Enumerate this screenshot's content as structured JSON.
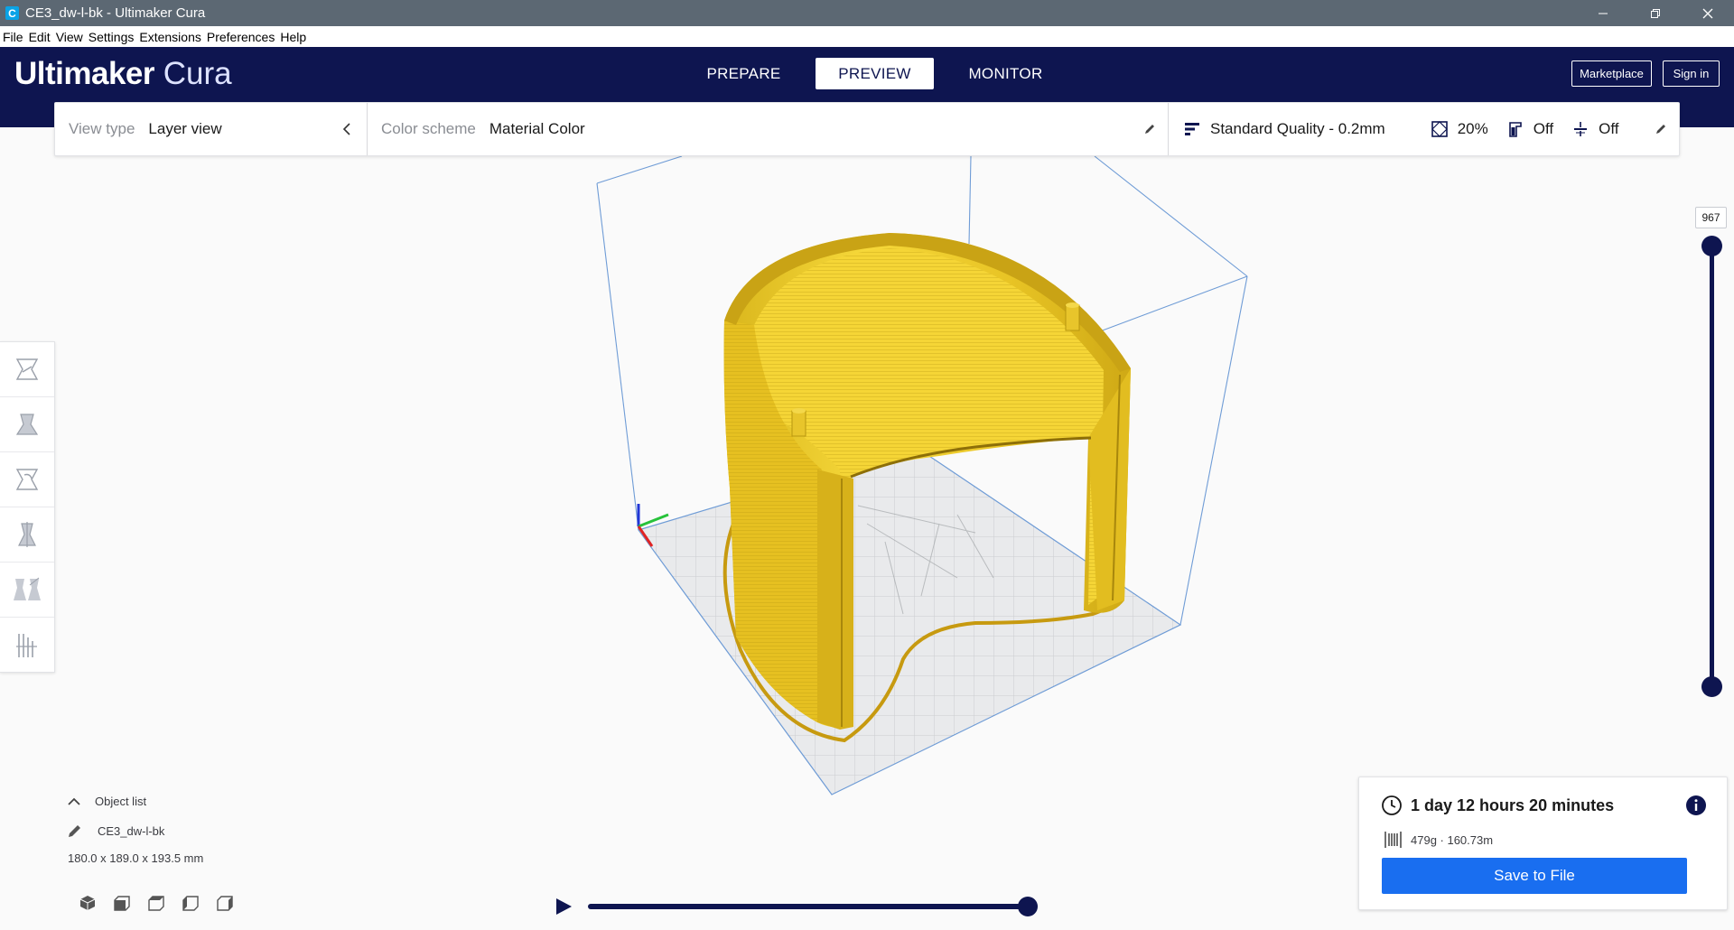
{
  "window": {
    "title": "CE3_dw-l-bk - Ultimaker Cura",
    "app_icon": "C"
  },
  "menu": [
    "File",
    "Edit",
    "View",
    "Settings",
    "Extensions",
    "Preferences",
    "Help"
  ],
  "header": {
    "brand_bold": "Ultimaker",
    "brand_light": "Cura",
    "tabs": [
      {
        "label": "PREPARE",
        "active": false
      },
      {
        "label": "PREVIEW",
        "active": true
      },
      {
        "label": "MONITOR",
        "active": false
      }
    ],
    "marketplace_label": "Marketplace",
    "signin_label": "Sign in"
  },
  "view_toolbar": {
    "view_type_label": "View type",
    "view_type_value": "Layer view",
    "color_scheme_label": "Color scheme",
    "color_scheme_value": "Material Color",
    "quality": "Standard Quality - 0.2mm",
    "infill": "20%",
    "support": "Off",
    "adhesion": "Off"
  },
  "layer_slider": {
    "max_layer": "967",
    "upper_fraction": 1.0,
    "lower_fraction": 0.0
  },
  "object_list": {
    "header": "Object list",
    "object_name": "CE3_dw-l-bk",
    "dimensions": "180.0 x 189.0 x 193.5 mm"
  },
  "simulation": {
    "progress": 1.0
  },
  "print_info": {
    "time": "1 day 12 hours 20 minutes",
    "material": "479g · 160.73m",
    "save_label": "Save to File"
  },
  "colors": {
    "header_bg": "#0e1550",
    "accent_blue": "#196ef0",
    "model_yellow": "#f2d22e",
    "titlebar_bg": "#5c6873"
  },
  "icons": {
    "tools": [
      "move-icon",
      "scale-icon",
      "rotate-icon",
      "mirror-icon",
      "per-model-settings-icon",
      "support-blocker-icon"
    ],
    "orientation": [
      "3d-view-icon",
      "front-view-icon",
      "top-view-icon",
      "left-view-icon",
      "right-view-icon"
    ]
  }
}
